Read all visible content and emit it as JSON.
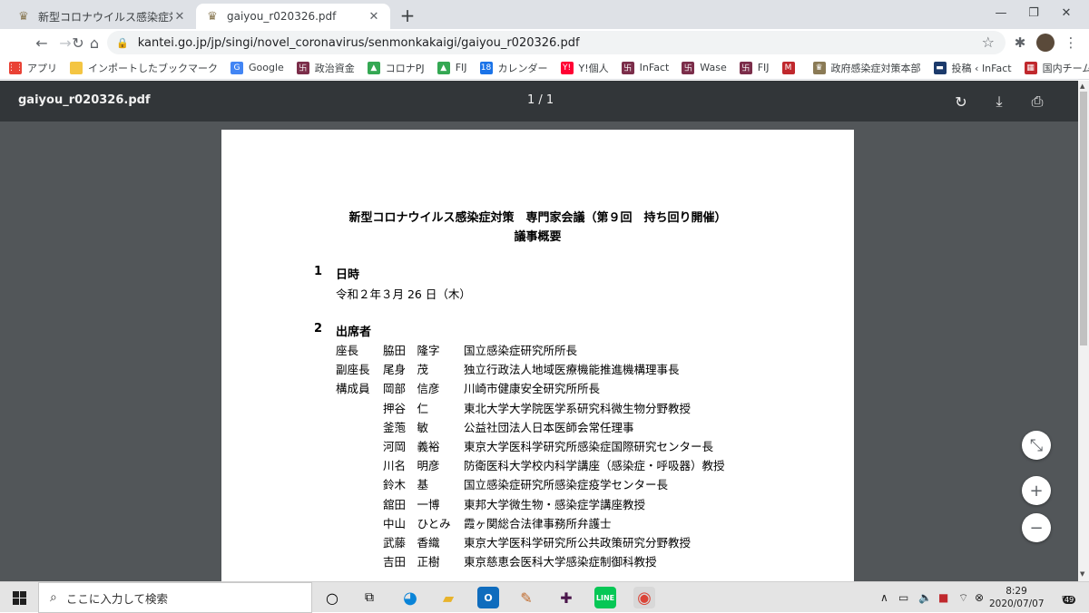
{
  "browser": {
    "tabs": [
      {
        "title": "新型コロナウイルス感染症対策本部",
        "active": false
      },
      {
        "title": "gaiyou_r020326.pdf",
        "active": true
      }
    ],
    "url": "kantei.go.jp/jp/singi/novel_coronavirus/senmonkakaigi/gaiyou_r020326.pdf",
    "bookmarks": [
      {
        "label": "アプリ",
        "icon": "apps-grid-icon",
        "color": "#e94235"
      },
      {
        "label": "インポートしたブックマーク",
        "icon": "folder-icon",
        "color": "#f4c542"
      },
      {
        "label": "Google",
        "icon": "google-icon",
        "color": "#4285f4"
      },
      {
        "label": "政治資金",
        "icon": "maroon-grid-icon",
        "color": "#7b2d4a"
      },
      {
        "label": "コロナPJ",
        "icon": "drive-icon",
        "color": "#34a853"
      },
      {
        "label": "FIJ",
        "icon": "drive-icon",
        "color": "#34a853"
      },
      {
        "label": "カレンダー",
        "icon": "calendar-icon",
        "color": "#1a73e8"
      },
      {
        "label": "Y!個人",
        "icon": "yahoo-icon",
        "color": "#ff0033"
      },
      {
        "label": "InFact",
        "icon": "maroon-grid-icon",
        "color": "#7b2d4a"
      },
      {
        "label": "Wase",
        "icon": "maroon-grid-icon",
        "color": "#7b2d4a"
      },
      {
        "label": "FIJ",
        "icon": "maroon-grid-icon",
        "color": "#7b2d4a"
      },
      {
        "label": "",
        "icon": "red-m-icon",
        "color": "#c0282d"
      },
      {
        "label": "政府感染症対策本部",
        "icon": "kantei-icon",
        "color": "#8a7a55"
      },
      {
        "label": "投稿 ‹ InFact",
        "icon": "infact-icon",
        "color": "#1b3a6b"
      },
      {
        "label": "国内チーム | Trello",
        "icon": "trello-icon",
        "color": "#c0282d"
      }
    ]
  },
  "pdf": {
    "filename": "gaiyou_r020326.pdf",
    "page_indicator": "1 / 1",
    "title_line1": "新型コロナウイルス感染症対策　専門家会議（第９回　持ち回り開催）",
    "title_line2": "議事概要",
    "sections": [
      {
        "num": "1",
        "title": "日時"
      },
      {
        "num": "2",
        "title": "出席者"
      }
    ],
    "date_text": "令和２年３月 26 日（木）",
    "attendees": [
      {
        "role": "座長",
        "name": "脇田　隆字",
        "affiliation": "国立感染症研究所所長"
      },
      {
        "role": "副座長",
        "name": "尾身　茂",
        "affiliation": "独立行政法人地域医療機能推進機構理事長"
      },
      {
        "role": "構成員",
        "name": "岡部　信彦",
        "affiliation": "川崎市健康安全研究所所長"
      },
      {
        "role": "",
        "name": "押谷　仁",
        "affiliation": "東北大学大学院医学系研究科微生物分野教授"
      },
      {
        "role": "",
        "name": "釜萢　敏",
        "affiliation": "公益社団法人日本医師会常任理事"
      },
      {
        "role": "",
        "name": "河岡　義裕",
        "affiliation": "東京大学医科学研究所感染症国際研究センター長"
      },
      {
        "role": "",
        "name": "川名　明彦",
        "affiliation": "防衛医科大学校内科学講座（感染症・呼吸器）教授"
      },
      {
        "role": "",
        "name": "鈴木　基",
        "affiliation": "国立感染症研究所感染症疫学センター長"
      },
      {
        "role": "",
        "name": "舘田　一博",
        "affiliation": "東邦大学微生物・感染症学講座教授"
      },
      {
        "role": "",
        "name": "中山　ひとみ",
        "affiliation": "霞ヶ関総合法律事務所弁護士"
      },
      {
        "role": "",
        "name": "武藤　香織",
        "affiliation": "東京大学医科学研究所公共政策研究分野教授"
      },
      {
        "role": "",
        "name": "吉田　正樹",
        "affiliation": "東京慈恵会医科大学感染症制御科教授"
      }
    ]
  },
  "taskbar": {
    "search_placeholder": "ここに入力して検索",
    "time": "8:29",
    "date": "2020/07/07",
    "notification_count": "49"
  }
}
